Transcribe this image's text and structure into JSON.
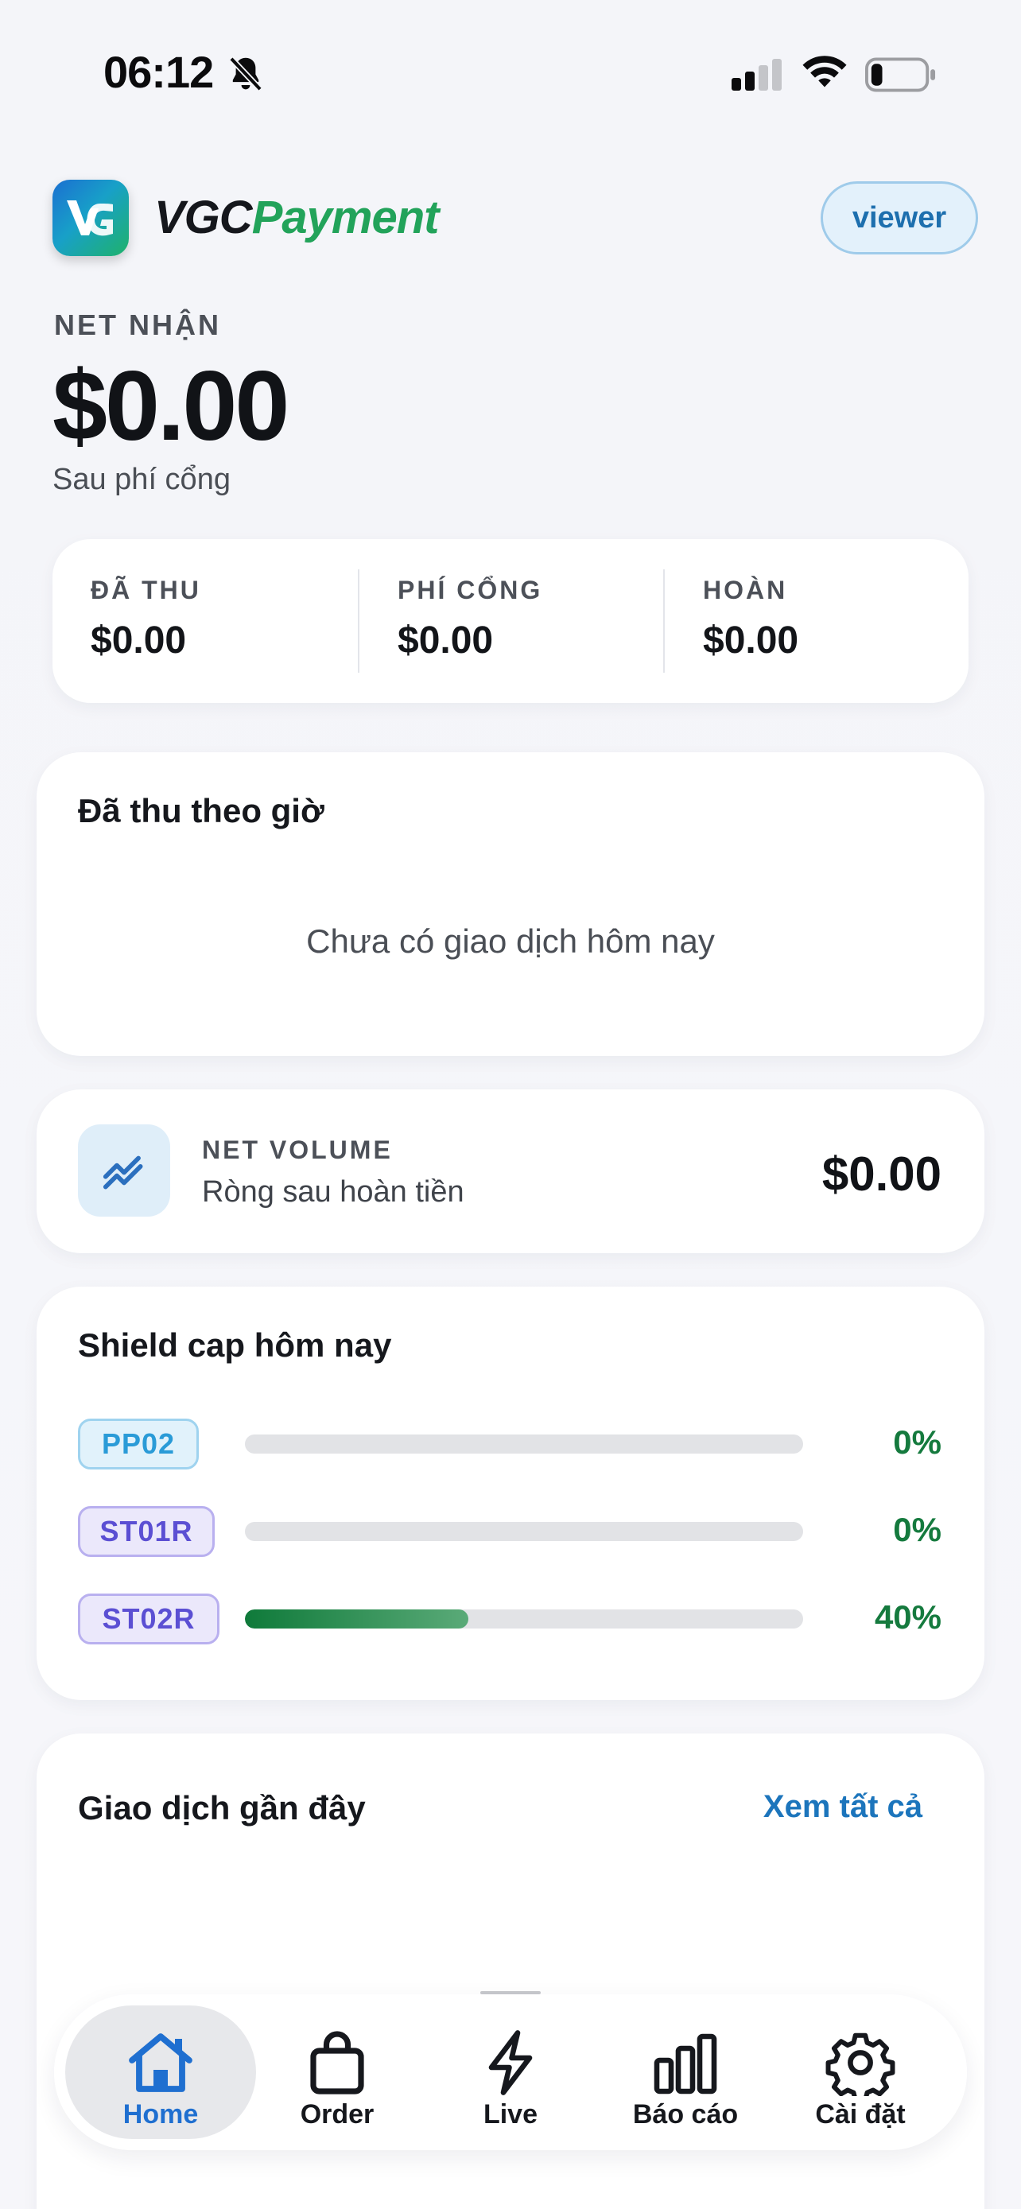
{
  "status_bar": {
    "time": "06:12"
  },
  "header": {
    "brand_part1": "VGC",
    "brand_part2": "Payment",
    "role_button": "viewer"
  },
  "net": {
    "label": "NET NHẬN",
    "value": "$0.00",
    "subtitle": "Sau phí cổng"
  },
  "stats": [
    {
      "label": "ĐÃ THU",
      "value": "$0.00"
    },
    {
      "label": "PHÍ CỔNG",
      "value": "$0.00"
    },
    {
      "label": "HOÀN",
      "value": "$0.00"
    }
  ],
  "hourly": {
    "title": "Đã thu theo giờ",
    "empty_text": "Chưa có giao dịch hôm nay"
  },
  "net_volume": {
    "label": "NET VOLUME",
    "subtitle": "Ròng sau hoàn tiền",
    "value": "$0.00"
  },
  "shield_cap": {
    "title": "Shield cap hôm nay",
    "rows": [
      {
        "tag": "PP02",
        "percent_label": "0%",
        "fill": 0
      },
      {
        "tag": "ST01R",
        "percent_label": "0%",
        "fill": 0
      },
      {
        "tag": "ST02R",
        "percent_label": "40%",
        "fill": 0.4
      }
    ]
  },
  "recent": {
    "title": "Giao dịch gần đây",
    "see_all": "Xem tất cả"
  },
  "tabs": [
    {
      "label": "Home",
      "icon": "home-icon",
      "active": true
    },
    {
      "label": "Order",
      "icon": "bag-icon",
      "active": false
    },
    {
      "label": "Live",
      "icon": "bolt-icon",
      "active": false
    },
    {
      "label": "Báo cáo",
      "icon": "bar-chart-icon",
      "active": false
    },
    {
      "label": "Cài đặt",
      "icon": "gear-icon",
      "active": false
    }
  ],
  "colors": {
    "accent": "#1f6fd0",
    "brand_green": "#22a35a",
    "progress_green": "#157a3e"
  }
}
